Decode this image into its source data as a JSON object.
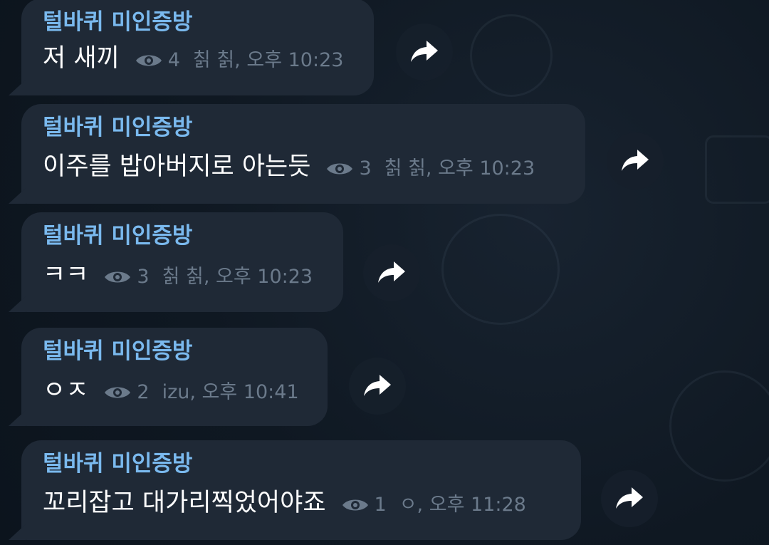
{
  "messages": [
    {
      "sender": "털바퀴 미인증방",
      "text": "저 새끼",
      "views": "4",
      "author_time": "칡 칡, 오후 10:23"
    },
    {
      "sender": "털바퀴 미인증방",
      "text": "이주를 밥아버지로 아는듯",
      "views": "3",
      "author_time": "칡 칡, 오후 10:23"
    },
    {
      "sender": "털바퀴 미인증방",
      "text": "ㅋㅋ",
      "views": "3",
      "author_time": "칡 칡, 오후 10:23"
    },
    {
      "sender": "털바퀴 미인증방",
      "text": "ㅇㅈ",
      "views": "2",
      "author_time": "izu, 오후 10:41"
    },
    {
      "sender": "털바퀴 미인증방",
      "text": "꼬리잡고 대가리찍었어야죠",
      "views": "1",
      "author_time": "ㅇ, 오후 11:28"
    }
  ],
  "icons": {
    "views": "eye-icon",
    "forward": "share-arrow-icon"
  },
  "colors": {
    "background": "#0e1621",
    "bubble": "#1f2936",
    "sender": "#7ab9ee",
    "text": "#ffffff",
    "meta": "#6b7a8b"
  }
}
